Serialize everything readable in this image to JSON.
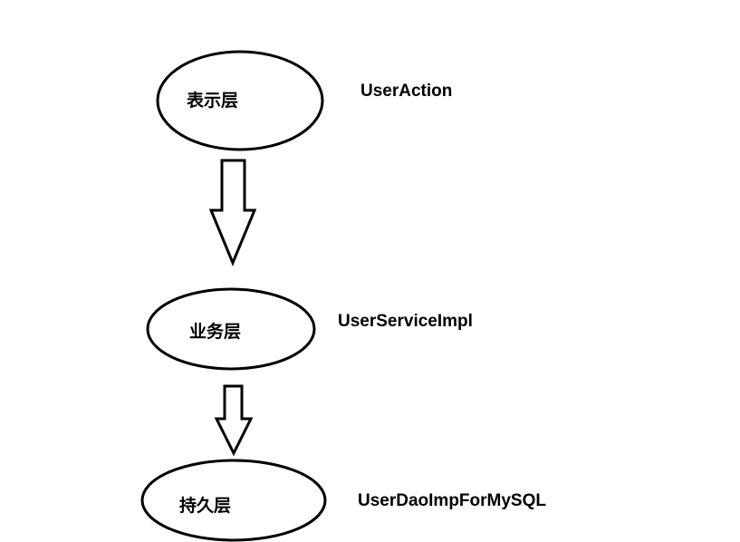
{
  "layers": [
    {
      "name": "表示层",
      "class_name": "UserAction"
    },
    {
      "name": "业务层",
      "class_name": "UserServiceImpl"
    },
    {
      "name": "持久层",
      "class_name": "UserDaoImpForMySQL"
    }
  ],
  "colors": {
    "background": "#ffffff",
    "stroke": "#000000",
    "text": "#000000"
  }
}
